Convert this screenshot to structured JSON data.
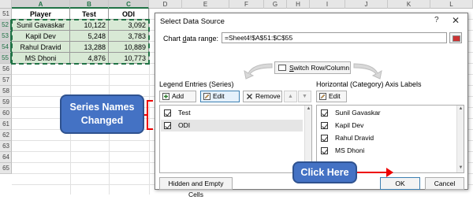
{
  "spreadsheet": {
    "columns": [
      "A",
      "B",
      "C",
      "D",
      "E",
      "F",
      "G",
      "H",
      "I",
      "J",
      "K",
      "L"
    ],
    "row_numbers": [
      "51",
      "52",
      "53",
      "54",
      "55",
      "56",
      "57",
      "58",
      "59",
      "60",
      "61",
      "62",
      "63",
      "64",
      "65"
    ],
    "table": {
      "headers": [
        "Player",
        "Test",
        "ODI"
      ],
      "rows": [
        [
          "Sunil Gavaskar",
          "10,122",
          "3,092"
        ],
        [
          "Kapil Dev",
          "5,248",
          "3,783"
        ],
        [
          "Rahul Dravid",
          "13,288",
          "10,889"
        ],
        [
          "MS Dhoni",
          "4,876",
          "10,773"
        ]
      ]
    },
    "selection_color": "#217346"
  },
  "dialog": {
    "title": "Select Data Source",
    "help": "?",
    "close": "✕",
    "range_label_pre": "Chart ",
    "range_label_u": "d",
    "range_label_post": "ata range:",
    "range_value": "=Sheet4!$A$51:$C$55",
    "switch_label_pre": "S",
    "switch_label_post": "witch Row/Column",
    "legend": {
      "label": "Legend Entries (Series)",
      "add_label": "Add",
      "edit_label": "Edit",
      "remove_label": "Remove",
      "move_up": "▲",
      "move_down": "▼",
      "items": [
        "Test",
        "ODI"
      ]
    },
    "axis": {
      "label": "Horizontal (Category) Axis Labels",
      "edit_label": "Edit",
      "items": [
        "Sunil Gavaskar",
        "Kapil Dev",
        "Rahul Dravid",
        "MS Dhoni"
      ]
    },
    "hidden_cells_label": "Hidden and Empty Cells",
    "ok_label": "OK",
    "cancel_label": "Cancel"
  },
  "annotations": {
    "series_callout_line1": "Series Names",
    "series_callout_line2": "Changed",
    "click_callout": "Click Here",
    "callout_color": "#4472c4",
    "marker_color": "#e00000"
  }
}
